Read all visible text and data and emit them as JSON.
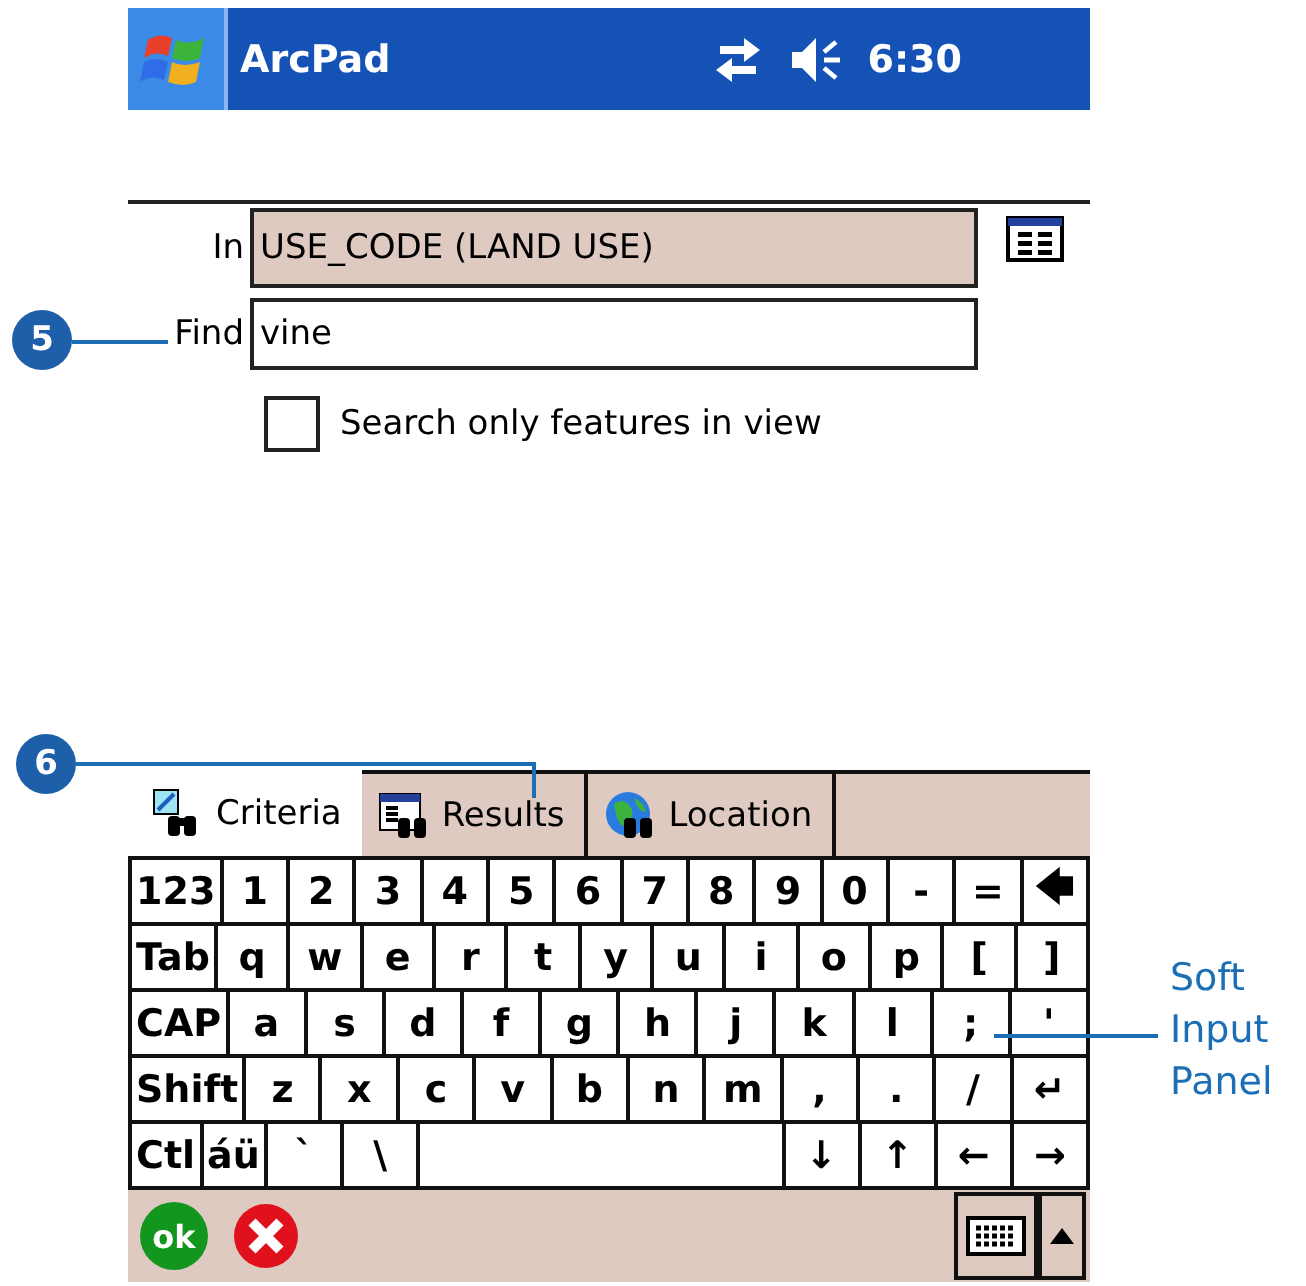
{
  "title_bar": {
    "app": "ArcPad",
    "time": "6:30"
  },
  "form": {
    "in_label": "In",
    "in_value": "USE_CODE (LAND USE)",
    "find_label": "Find",
    "find_value": "vine",
    "option": {
      "label": "Search only features in view",
      "checked": false
    }
  },
  "tabs": [
    {
      "label": "Criteria",
      "selected": true
    },
    {
      "label": "Results",
      "selected": false
    },
    {
      "label": "Location",
      "selected": false
    }
  ],
  "keyboard": {
    "key_rows": [
      {
        "keys": [
          {
            "label": "123",
            "kind": "wide"
          },
          {
            "label": "1",
            "kind": "key"
          },
          {
            "label": "2",
            "kind": "key"
          },
          {
            "label": "3",
            "kind": "key"
          },
          {
            "label": "4",
            "kind": "key"
          },
          {
            "label": "5",
            "kind": "key"
          },
          {
            "label": "6",
            "kind": "key"
          },
          {
            "label": "7",
            "kind": "key"
          },
          {
            "label": "8",
            "kind": "key"
          },
          {
            "label": "9",
            "kind": "key"
          },
          {
            "label": "0",
            "kind": "key"
          },
          {
            "label": "-",
            "kind": "key"
          },
          {
            "label": "=",
            "kind": "key"
          },
          {
            "label": "🡄",
            "kind": "key"
          }
        ]
      },
      {
        "keys": [
          {
            "label": "Tab",
            "kind": "wide"
          },
          {
            "label": "q",
            "kind": "key"
          },
          {
            "label": "w",
            "kind": "key"
          },
          {
            "label": "e",
            "kind": "key"
          },
          {
            "label": "r",
            "kind": "key"
          },
          {
            "label": "t",
            "kind": "key"
          },
          {
            "label": "y",
            "kind": "key"
          },
          {
            "label": "u",
            "kind": "key"
          },
          {
            "label": "i",
            "kind": "key"
          },
          {
            "label": "o",
            "kind": "key"
          },
          {
            "label": "p",
            "kind": "key"
          },
          {
            "label": "[",
            "kind": "key"
          },
          {
            "label": "]",
            "kind": "key"
          }
        ]
      },
      {
        "keys": [
          {
            "label": "CAP",
            "kind": "wide"
          },
          {
            "label": "a",
            "kind": "key"
          },
          {
            "label": "s",
            "kind": "key"
          },
          {
            "label": "d",
            "kind": "key"
          },
          {
            "label": "f",
            "kind": "key"
          },
          {
            "label": "g",
            "kind": "key"
          },
          {
            "label": "h",
            "kind": "key"
          },
          {
            "label": "j",
            "kind": "key"
          },
          {
            "label": "k",
            "kind": "key"
          },
          {
            "label": "l",
            "kind": "key"
          },
          {
            "label": ";",
            "kind": "key"
          },
          {
            "label": "'",
            "kind": "key"
          }
        ]
      },
      {
        "keys": [
          {
            "label": "Shift",
            "kind": "wide"
          },
          {
            "label": "z",
            "kind": "key"
          },
          {
            "label": "x",
            "kind": "key"
          },
          {
            "label": "c",
            "kind": "key"
          },
          {
            "label": "v",
            "kind": "key"
          },
          {
            "label": "b",
            "kind": "key"
          },
          {
            "label": "n",
            "kind": "key"
          },
          {
            "label": "m",
            "kind": "key"
          },
          {
            "label": ",",
            "kind": "key"
          },
          {
            "label": ".",
            "kind": "key"
          },
          {
            "label": "/",
            "kind": "key"
          },
          {
            "label": "↵",
            "kind": "key"
          }
        ]
      },
      {
        "keys": [
          {
            "label": "Ctl",
            "kind": "wide"
          },
          {
            "label": "áü",
            "kind": "wide"
          },
          {
            "label": "`",
            "kind": "key"
          },
          {
            "label": "\\",
            "kind": "key"
          },
          {
            "kind": "space"
          },
          {
            "label": "↓",
            "kind": "key"
          },
          {
            "label": "↑",
            "kind": "key"
          },
          {
            "label": "←",
            "kind": "key"
          },
          {
            "label": "→",
            "kind": "key"
          }
        ]
      }
    ]
  },
  "bottom_bar": {
    "ok": "ok"
  },
  "callouts": [
    {
      "number": "5"
    },
    {
      "number": "6"
    }
  ],
  "annotation": {
    "lines": [
      "Soft",
      "Input",
      "Panel"
    ]
  }
}
